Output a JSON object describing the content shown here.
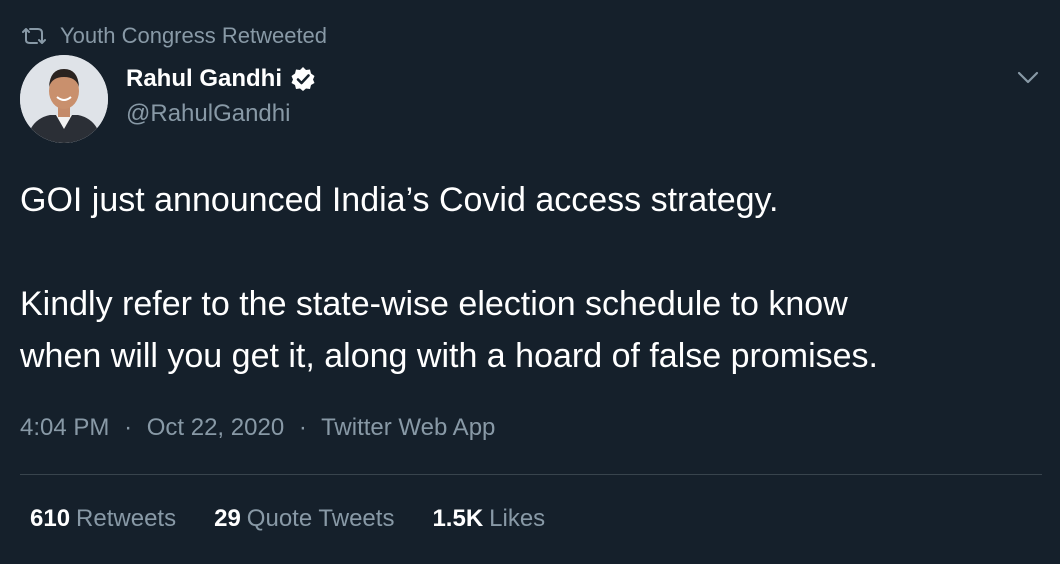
{
  "context": {
    "retweeted_by": "Youth Congress Retweeted",
    "icon": "retweet-icon"
  },
  "author": {
    "display_name": "Rahul Gandhi",
    "handle": "@RahulGandhi",
    "verified": true,
    "avatar_icon": "avatar-photo"
  },
  "menu": {
    "icon": "chevron-down-icon"
  },
  "tweet": {
    "paragraphs": [
      "GOI just announced India’s Covid access strategy.",
      "Kindly refer to the state-wise election schedule to know",
      "when will you get it, along with a hoard of false promises."
    ]
  },
  "meta": {
    "time": "4:04 PM",
    "separator": "·",
    "date": "Oct 22, 2020",
    "source": "Twitter Web App"
  },
  "stats": {
    "retweets": {
      "count": "610",
      "label": "Retweets"
    },
    "quote_tweets": {
      "count": "29",
      "label": "Quote Tweets"
    },
    "likes": {
      "count": "1.5K",
      "label": "Likes"
    }
  },
  "colors": {
    "background": "#15202b",
    "primary_text": "#ffffff",
    "secondary_text": "#8899a6",
    "divider": "#38444d"
  }
}
